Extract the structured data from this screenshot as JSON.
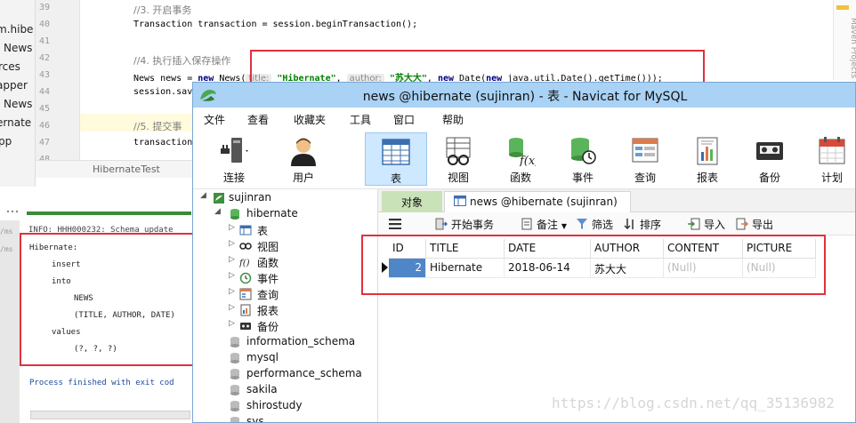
{
  "ide": {
    "project_tree": [
      "m.hibe",
      "News",
      "rces",
      "apper",
      "News",
      "ernate",
      "pp"
    ],
    "line_numbers": [
      "39",
      "40",
      "41",
      "42",
      "43",
      "44",
      "45",
      "46",
      "47",
      "48"
    ],
    "code": {
      "comment_start_tx": "//3. 开启事务",
      "tx_line": "Transaction transaction = session.beginTransaction();",
      "comment_insert": "//4. 执行插入保存操作",
      "news_line_a": "News news = ",
      "kw_new": "new",
      "news_line_b": " News(",
      "hint_title": "title:",
      "arg_title": "\"Hibernate\"",
      "comma1": ", ",
      "hint_author": "author:",
      "arg_author": "\"苏大大\"",
      "news_line_c": ", ",
      "kw_new2": "new",
      "news_line_d": " Date(",
      "kw_new3": "new",
      "news_line_e": " java.util.Date().getTime()));",
      "save_line": "session.sav",
      "comment_commit": "//5. 提交事",
      "commit_line": "transaction"
    },
    "breadcrumb": "HibernateTest",
    "breadcrumb_sep": "t",
    "console": {
      "log_head": "INFO: HHH000232: Schema update",
      "side_labels": [
        "/ms",
        "/ms"
      ],
      "sql_lines": [
        "Hibernate:",
        "insert",
        "into",
        "NEWS",
        "(TITLE, AUTHOR, DATE)",
        "values",
        "(?, ?, ?)"
      ],
      "process_finished": "Process finished with exit cod"
    },
    "right_strip": "Maven Projects"
  },
  "navicat": {
    "title": "news @hibernate (sujinran) - 表 - Navicat for MySQL",
    "menu": [
      "文件",
      "查看",
      "收藏夹",
      "工具",
      "窗口",
      "帮助"
    ],
    "toolbar": [
      "连接",
      "用户",
      "表",
      "视图",
      "函数",
      "事件",
      "查询",
      "报表",
      "备份",
      "计划"
    ],
    "tree": {
      "connection": "sujinran",
      "database": "hibernate",
      "children": [
        "表",
        "视图",
        "函数",
        "事件",
        "查询",
        "报表",
        "备份"
      ],
      "other_dbs": [
        "information_schema",
        "mysql",
        "performance_schema",
        "sakila",
        "shirostudy",
        "sys"
      ]
    },
    "tabs": {
      "objects": "对象",
      "news": "news @hibernate (sujinran) ..."
    },
    "grid_toolbar": {
      "begin_tx": "开始事务",
      "note": "备注",
      "filter": "筛选",
      "sort": "排序",
      "import": "导入",
      "export": "导出"
    },
    "grid": {
      "columns": [
        "ID",
        "TITLE",
        "DATE",
        "AUTHOR",
        "CONTENT",
        "PICTURE"
      ],
      "row": [
        "2",
        "Hibernate",
        "2018-06-14",
        "苏大大",
        "(Null)",
        "(Null)"
      ]
    }
  },
  "watermark": "https://blog.csdn.net/qq_35136982",
  "colors": {
    "annotation_red": "#e0313d",
    "title_bar": "#a9d2f5",
    "selected_cell": "#4e86c7"
  }
}
